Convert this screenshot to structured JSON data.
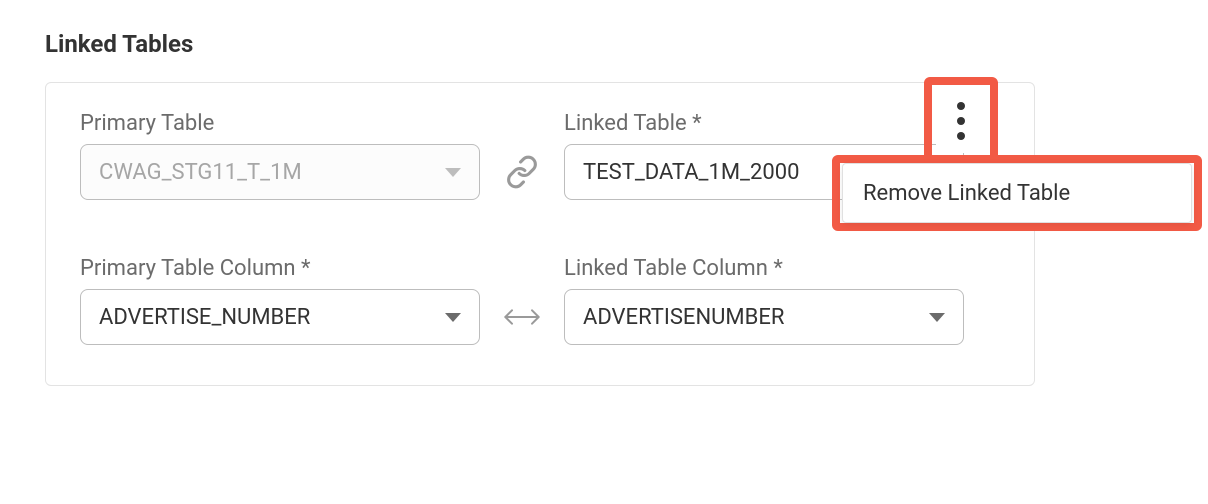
{
  "section_title": "Linked Tables",
  "row1": {
    "primary_label": "Primary Table",
    "primary_value": "CWAG_STG11_T_1M",
    "linked_label": "Linked Table *",
    "linked_value": "TEST_DATA_1M_2000"
  },
  "row2": {
    "primary_label": "Primary Table Column *",
    "primary_value": "ADVERTISE_NUMBER",
    "linked_label": "Linked Table Column *",
    "linked_value": "ADVERTISENUMBER"
  },
  "menu": {
    "remove_label": "Remove Linked Table"
  }
}
